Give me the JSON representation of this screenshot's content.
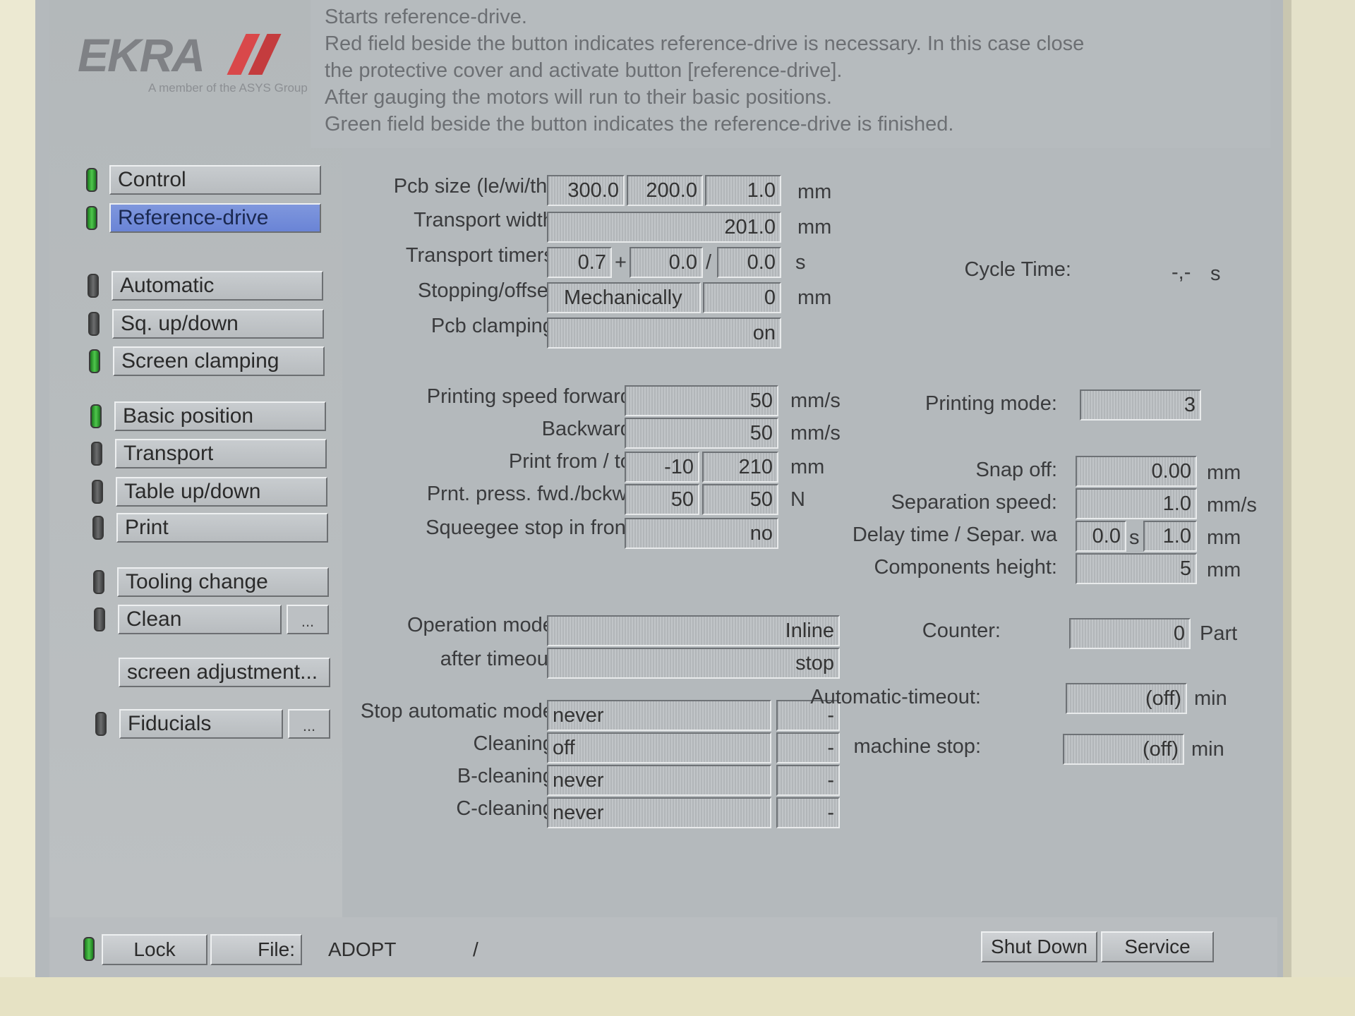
{
  "logo": {
    "text": "EKRA",
    "tagline": "A member of the ASYS Group"
  },
  "info_lines": [
    "Starts reference-drive.",
    "Red field beside the button indicates reference-drive is necessary. In this case close",
    "the protective cover and activate button [reference-drive].",
    "After gauging the motors will run to their basic positions.",
    "Green field beside the button indicates the reference-drive is finished."
  ],
  "sidebar": {
    "control": "Control",
    "reference_drive": "Reference-drive",
    "automatic": "Automatic",
    "sq_updown": "Sq. up/down",
    "screen_clamping": "Screen clamping",
    "basic_position": "Basic position",
    "transport": "Transport",
    "table_updown": "Table up/down",
    "print": "Print",
    "tooling_change": "Tooling change",
    "clean": "Clean",
    "clean_more": "...",
    "screen_adjustment": "screen adjustment...",
    "fiducials": "Fiducials",
    "fiducials_more": "..."
  },
  "params": {
    "pcb_size_label": "Pcb size (le/wi/th):",
    "pcb_le": "300.0",
    "pcb_wi": "200.0",
    "pcb_th": "1.0",
    "pcb_unit": "mm",
    "transport_width_label": "Transport width:",
    "transport_width": "201.0",
    "transport_width_unit": "mm",
    "transport_timers_label": "Transport timers:",
    "timer1": "0.7",
    "plus": "+",
    "timer2": "0.0",
    "slash": "/",
    "timer3": "0.0",
    "timer_unit": "s",
    "stopping_label": "Stopping/offset:",
    "stopping_mode": "Mechanically",
    "stopping_offset": "0",
    "stopping_unit": "mm",
    "pcb_clamping_label": "Pcb clamping:",
    "pcb_clamping": "on",
    "cycle_time_label": "Cycle Time:",
    "cycle_time_value": "-,-",
    "cycle_time_unit": "s"
  },
  "print_params": {
    "speed_fwd_label": "Printing speed forward:",
    "speed_fwd": "50",
    "speed_fwd_unit": "mm/s",
    "backward_label": "Backward:",
    "backward": "50",
    "backward_unit": "mm/s",
    "print_from_label": "Print from / to:",
    "print_from": "-10",
    "print_to": "210",
    "print_from_unit": "mm",
    "press_label": "Prnt. press. fwd./bckw.:",
    "press_fwd": "50",
    "press_bckw": "50",
    "press_unit": "N",
    "squeegee_label": "Squeegee stop in front:",
    "squeegee": "no",
    "printing_mode_label": "Printing mode:",
    "printing_mode": "3",
    "snap_off_label": "Snap off:",
    "snap_off": "0.00",
    "snap_off_unit": "mm",
    "sep_speed_label": "Separation speed:",
    "sep_speed": "1.0",
    "sep_speed_unit": "mm/s",
    "delay_label": "Delay time / Separ. wa",
    "delay": "0.0",
    "delay_unit": "s",
    "separ_wa": "1.0",
    "separ_wa_unit": "mm",
    "comp_height_label": "Components height:",
    "comp_height": "5",
    "comp_height_unit": "mm"
  },
  "operation": {
    "op_mode_label": "Operation mode:",
    "op_mode": "Inline",
    "after_timeout_label": "after timeout:",
    "after_timeout": "stop",
    "counter_label": "Counter:",
    "counter": "0",
    "counter_unit": "Part",
    "stop_auto_label": "Stop automatic mode:",
    "stop_auto": "never",
    "stop_auto_extra": "-",
    "cleaning_label": "Cleaning:",
    "cleaning": "off",
    "cleaning_extra": "-",
    "b_cleaning_label": "B-cleaning:",
    "b_cleaning": "never",
    "b_cleaning_extra": "-",
    "c_cleaning_label": "C-cleaning:",
    "c_cleaning": "never",
    "c_cleaning_extra": "-",
    "auto_timeout_label": "Automatic-timeout:",
    "auto_timeout": "(off)",
    "auto_timeout_unit": "min",
    "machine_stop_label": "machine stop:",
    "machine_stop": "(off)",
    "machine_stop_unit": "min"
  },
  "bottom": {
    "lock": "Lock",
    "file": "File:",
    "program": "ADOPT",
    "path": "/",
    "shutdown": "Shut Down",
    "service": "Service"
  },
  "colors": {
    "accent_active": "#6a84d6",
    "led_green": "#4fc64c",
    "logo_red": "#d9484a"
  }
}
